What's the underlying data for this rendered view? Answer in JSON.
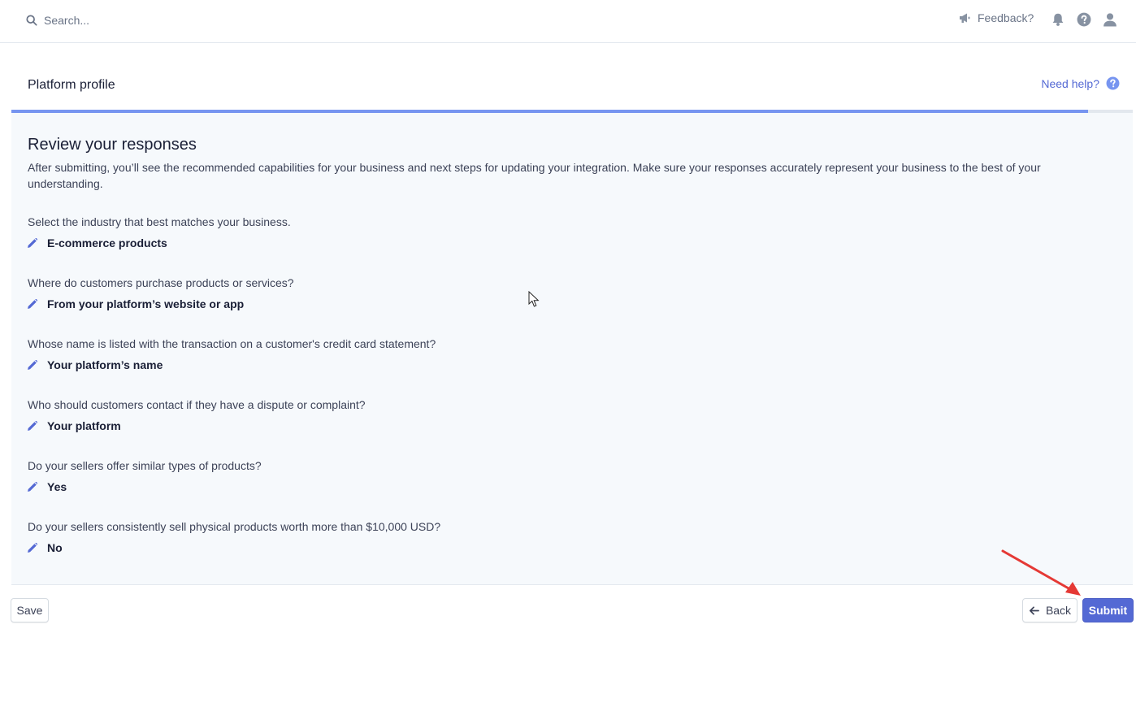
{
  "topbar": {
    "search_placeholder": "Search...",
    "feedback_label": "Feedback?"
  },
  "header": {
    "title": "Platform profile",
    "need_help": "Need help?"
  },
  "progress": {
    "fraction": 0.96
  },
  "review": {
    "title": "Review your responses",
    "description": "After submitting, you’ll see the recommended capabilities for your business and next steps for updating your integration. Make sure your responses accurately represent your business to the best of your understanding.",
    "items": [
      {
        "question": "Select the industry that best matches your business.",
        "answer": "E-commerce products"
      },
      {
        "question": "Where do customers purchase products or services?",
        "answer": "From your platform’s website or app"
      },
      {
        "question": "Whose name is listed with the transaction on a customer's credit card statement?",
        "answer": "Your platform’s name"
      },
      {
        "question": "Who should customers contact if they have a dispute or complaint?",
        "answer": "Your platform"
      },
      {
        "question": "Do your sellers offer similar types of products?",
        "answer": "Yes"
      },
      {
        "question": "Do your sellers consistently sell physical products worth more than $10,000 USD?",
        "answer": "No"
      }
    ]
  },
  "footer": {
    "save_label": "Save",
    "back_label": "Back",
    "submit_label": "Submit"
  },
  "colors": {
    "accent": "#5469d4",
    "progress": "#7795f0",
    "annotation_arrow": "#e53935"
  },
  "icons": [
    "search-icon",
    "megaphone-icon",
    "bell-icon",
    "help-icon",
    "user-icon",
    "pencil-icon",
    "arrow-left-icon"
  ]
}
